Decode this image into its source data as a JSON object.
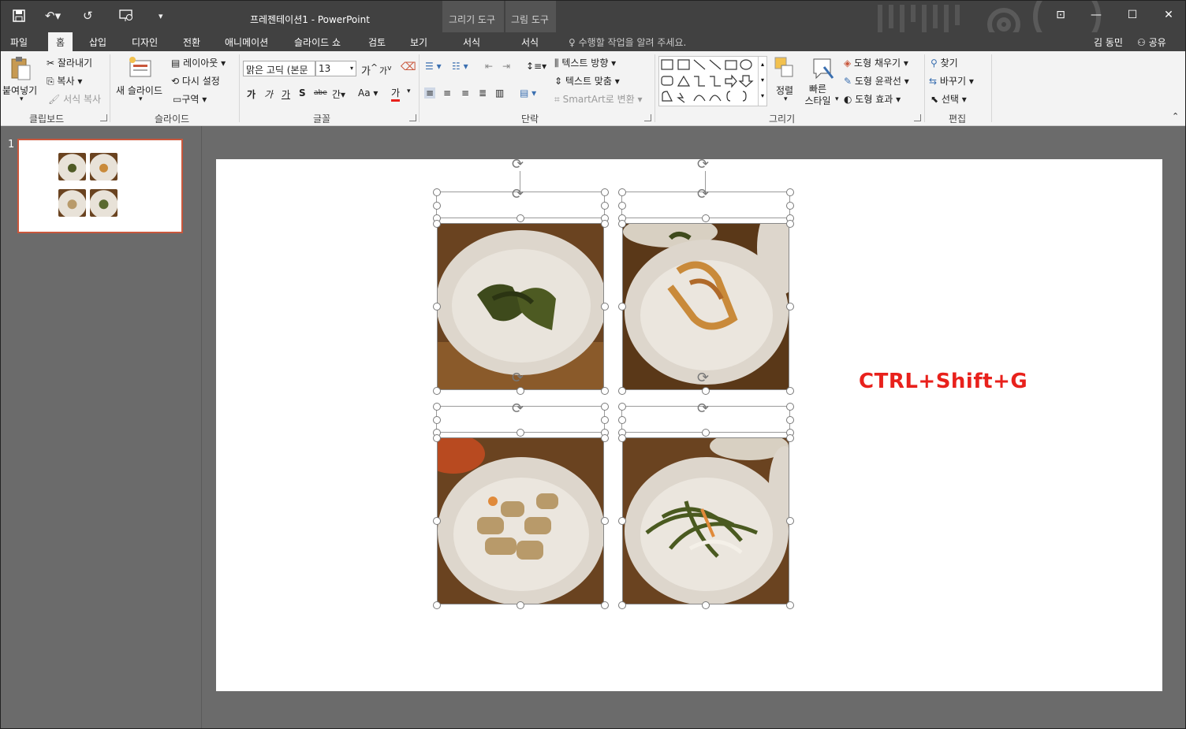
{
  "app": {
    "title": "프레젠테이션1 - PowerPoint",
    "context_groups": [
      {
        "label": "그리기 도구",
        "tab": "서식"
      },
      {
        "label": "그림 도구",
        "tab": "서식"
      }
    ]
  },
  "tabs": [
    "파일",
    "홈",
    "삽입",
    "디자인",
    "전환",
    "애니메이션",
    "슬라이드 쇼",
    "검토",
    "보기"
  ],
  "active_tab": "홈",
  "tell_me": "수행할 작업을 알려 주세요.",
  "user": "김 동민",
  "share": "공유",
  "ribbon": {
    "clipboard": {
      "paste": "붙여넣기",
      "cut": "잘라내기",
      "copy": "복사",
      "format_painter": "서식 복사",
      "label": "클립보드"
    },
    "slides": {
      "new_slide": "새 슬라이드",
      "layout": "레이아웃",
      "reset": "다시 설정",
      "section": "구역",
      "label": "슬라이드"
    },
    "font": {
      "name": "맑은 고딕 (본문",
      "size": "13",
      "label": "글꼴",
      "grow": "가",
      "shrink": "가",
      "bold": "가",
      "italic": "가",
      "underline": "가",
      "shadow": "S",
      "strike": "abe",
      "spacing": "간",
      "case": "Aa",
      "color": "가"
    },
    "paragraph": {
      "text_direction": "텍스트 방향",
      "align_text": "텍스트 맞춤",
      "smartart": "SmartArt로 변환",
      "label": "단락"
    },
    "drawing": {
      "arrange": "정렬",
      "quick_styles": "빠른 스타일",
      "fill": "도형 채우기",
      "outline": "도형 윤곽선",
      "effects": "도형 효과",
      "label": "그리기"
    },
    "editing": {
      "find": "찾기",
      "replace": "바꾸기",
      "select": "선택",
      "label": "편집"
    }
  },
  "thumbnails": [
    {
      "number": "1"
    }
  ],
  "slide": {
    "annotation": "CTRL+Shift+G"
  },
  "colors": {
    "accent": "#c9573c",
    "annotation": "#e8211c",
    "titlebar": "#414141",
    "ribbon": "#f3f3f3"
  }
}
